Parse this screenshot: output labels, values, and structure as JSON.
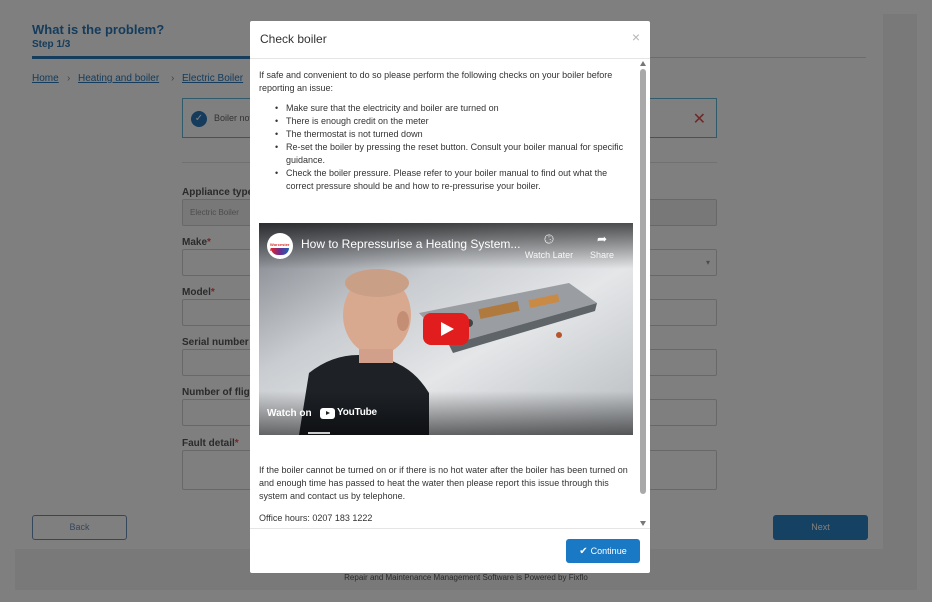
{
  "background": {
    "title": "What is the problem?",
    "step": "Step 1/3",
    "breadcrumb": [
      "Home",
      "Heating and boiler",
      "Electric Boiler"
    ],
    "alert_text": "Boiler not working",
    "fields": [
      {
        "label": "Appliance type",
        "required": "",
        "value": "Electric Boiler"
      },
      {
        "label": "Make",
        "required": "*",
        "value": ""
      },
      {
        "label": "Model",
        "required": "*",
        "value": ""
      },
      {
        "label": "Serial number",
        "required": "",
        "value": ""
      },
      {
        "label": "Number of flights",
        "required": "",
        "value": ""
      },
      {
        "label": "Fault detail",
        "required": "*",
        "value": ""
      }
    ],
    "back_label": "Back",
    "next_label": "Next",
    "footer": "Repair and Maintenance Management Software is Powered by Fixflo"
  },
  "modal": {
    "title": "Check boiler",
    "close_glyph": "×",
    "intro": "If safe and convenient to do so please perform the following checks on your boiler before reporting an issue:",
    "checks": [
      "Make sure that the electricity and boiler are turned on",
      "There is enough credit on the meter",
      "The thermostat is not turned down",
      "Re-set the boiler by pressing the reset button. Consult your boiler manual for specific guidance.",
      "Check the boiler pressure. Please refer to your boiler manual to find out what the correct pressure should be and how to re-pressurise your boiler."
    ],
    "video": {
      "title": "How to Repressurise a Heating System...",
      "channel_logo_text": "Worcester\nBOSCH",
      "watch_later": "Watch Later",
      "share": "Share",
      "watch_on": "Watch on",
      "youtube": "YouTube"
    },
    "after_video": "If the boiler cannot be turned on or if there is no hot water after the boiler has been turned on and enough time has passed to heat the water then please report this issue through this system and contact us by telephone.",
    "office_hours": "Office hours: 0207 183 1222",
    "continue_label": "Continue",
    "continue_icon": "✔"
  },
  "colors": {
    "accent": "#1a79c4",
    "play_red": "#e11d1d",
    "link": "#2a78b8"
  }
}
